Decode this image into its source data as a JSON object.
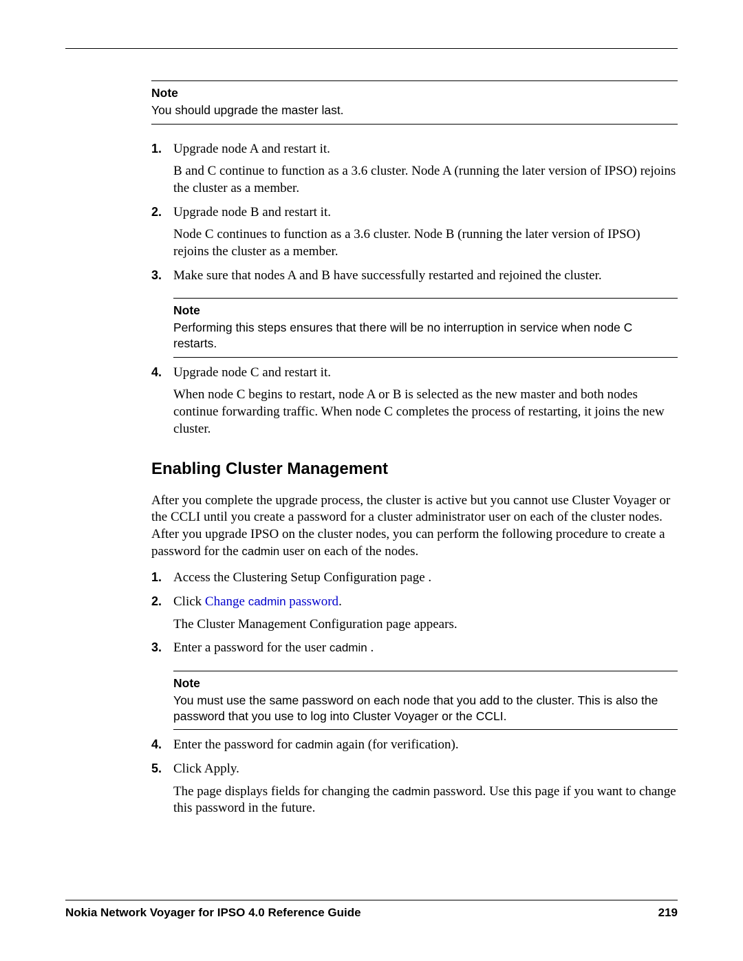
{
  "notes": {
    "top": {
      "label": "Note",
      "text": "You should upgrade the master last."
    },
    "mid": {
      "label": "Note",
      "text": "Performing this steps ensures that there will be no interruption in service when node C restarts."
    },
    "bottom": {
      "label": "Note",
      "text": "You must use the same password on each node that you add to the cluster. This is also the password that you use to log into Cluster Voyager or the CCLI."
    }
  },
  "list1": {
    "s1": {
      "lead": "Upgrade node A and restart it.",
      "body": "B and C continue to function as a 3.6 cluster. Node A (running the later version of IPSO) rejoins the cluster as a member."
    },
    "s2": {
      "lead": "Upgrade node B and restart it.",
      "body": "Node C continues to function as a 3.6 cluster. Node B (running the later version of IPSO) rejoins the cluster as a member."
    },
    "s3": {
      "lead": "Make sure that nodes A and B have successfully restarted and rejoined the cluster."
    },
    "s4": {
      "lead": "Upgrade node C and restart it.",
      "body": "When node C begins to restart, node A or B is selected as the new master and both nodes continue forwarding traffic. When node C completes the process of restarting, it joins the new cluster."
    }
  },
  "heading": "Enabling Cluster Management",
  "intro": {
    "part1": "After you complete the upgrade process, the cluster is active but you cannot use Cluster Voyager or the CCLI until you create a password for a cluster administrator user on each of the cluster nodes. After you upgrade IPSO on the cluster nodes, you can perform the following procedure to create a password for the ",
    "code1": "cadmin",
    "part2": " user on each of the nodes."
  },
  "list2": {
    "s1": {
      "lead": "Access the Clustering Setup Configuration page ."
    },
    "s2": {
      "pre": "Click ",
      "link1": "Change ",
      "code": "cadmin",
      "link2": " password",
      "post": ".",
      "body": "The Cluster Management Configuration page appears."
    },
    "s3": {
      "pre": "Enter a password for the user ",
      "code": "cadmin",
      "post": " ."
    },
    "s4": {
      "pre": "Enter the password for ",
      "code": "cadmin",
      "post": " again (for verification)."
    },
    "s5": {
      "lead": "Click Apply.",
      "body_pre": "The page displays fields for changing the ",
      "body_code": "cadmin",
      "body_post": " password. Use this page if you want to change this password in the future."
    }
  },
  "footer": {
    "title": "Nokia Network Voyager for IPSO 4.0 Reference Guide",
    "page": "219"
  }
}
